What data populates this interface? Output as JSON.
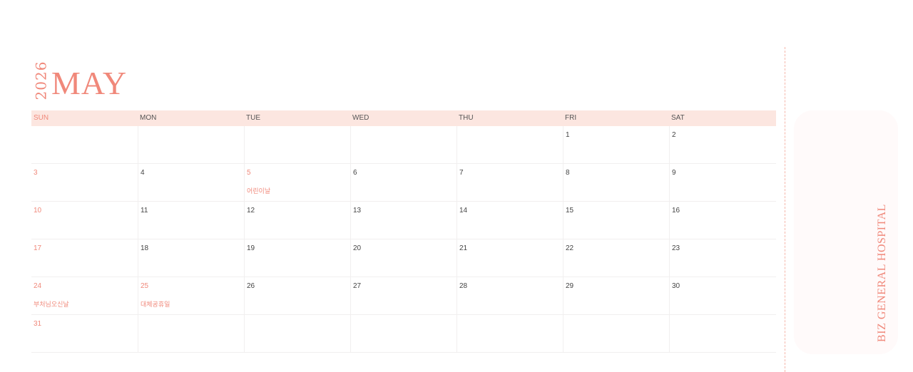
{
  "header": {
    "year": "2026",
    "month": "MAY"
  },
  "weekdays": [
    "SUN",
    "MON",
    "TUE",
    "WED",
    "THU",
    "FRI",
    "SAT"
  ],
  "weeks": [
    [
      {
        "day": "",
        "holiday": ""
      },
      {
        "day": "",
        "holiday": ""
      },
      {
        "day": "",
        "holiday": ""
      },
      {
        "day": "",
        "holiday": ""
      },
      {
        "day": "",
        "holiday": ""
      },
      {
        "day": "1",
        "holiday": ""
      },
      {
        "day": "2",
        "holiday": ""
      }
    ],
    [
      {
        "day": "3",
        "holiday": "",
        "red": true
      },
      {
        "day": "4",
        "holiday": ""
      },
      {
        "day": "5",
        "holiday": "어린이날",
        "red": true
      },
      {
        "day": "6",
        "holiday": ""
      },
      {
        "day": "7",
        "holiday": ""
      },
      {
        "day": "8",
        "holiday": ""
      },
      {
        "day": "9",
        "holiday": ""
      }
    ],
    [
      {
        "day": "10",
        "holiday": "",
        "red": true
      },
      {
        "day": "11",
        "holiday": ""
      },
      {
        "day": "12",
        "holiday": ""
      },
      {
        "day": "13",
        "holiday": ""
      },
      {
        "day": "14",
        "holiday": ""
      },
      {
        "day": "15",
        "holiday": ""
      },
      {
        "day": "16",
        "holiday": ""
      }
    ],
    [
      {
        "day": "17",
        "holiday": "",
        "red": true
      },
      {
        "day": "18",
        "holiday": ""
      },
      {
        "day": "19",
        "holiday": ""
      },
      {
        "day": "20",
        "holiday": ""
      },
      {
        "day": "21",
        "holiday": ""
      },
      {
        "day": "22",
        "holiday": ""
      },
      {
        "day": "23",
        "holiday": ""
      }
    ],
    [
      {
        "day": "24",
        "holiday": "부처님오신날",
        "red": true
      },
      {
        "day": "25",
        "holiday": "대체공휴일",
        "red": true
      },
      {
        "day": "26",
        "holiday": ""
      },
      {
        "day": "27",
        "holiday": ""
      },
      {
        "day": "28",
        "holiday": ""
      },
      {
        "day": "29",
        "holiday": ""
      },
      {
        "day": "30",
        "holiday": ""
      }
    ],
    [
      {
        "day": "31",
        "holiday": "",
        "red": true
      },
      {
        "day": "",
        "holiday": ""
      },
      {
        "day": "",
        "holiday": ""
      },
      {
        "day": "",
        "holiday": ""
      },
      {
        "day": "",
        "holiday": ""
      },
      {
        "day": "",
        "holiday": ""
      },
      {
        "day": "",
        "holiday": ""
      }
    ]
  ],
  "side_panel": {
    "title": "BIZ GENERAL HOSPITAL"
  },
  "colors": {
    "accent": "#f0887a",
    "header_band": "#fce6e0",
    "grid_line": "#f1efef",
    "text": "#444444"
  }
}
